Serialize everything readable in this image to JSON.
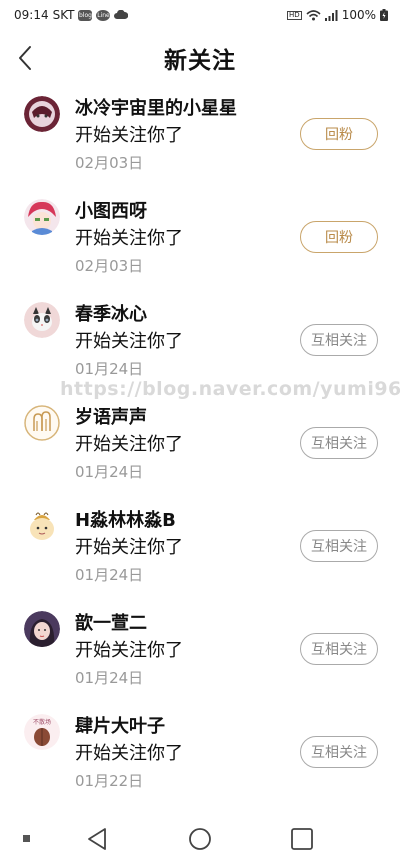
{
  "status_bar": {
    "time": "09:14",
    "carrier": "SKT",
    "app_badges": [
      "blog",
      "Line"
    ],
    "hd_label": "HD",
    "battery": "100%"
  },
  "header": {
    "title": "新关注"
  },
  "items": [
    {
      "name": "冰冷宇宙里的小星星",
      "message": "开始关注你了",
      "date": "02月03日",
      "button": "回粉",
      "button_style": "follow-back"
    },
    {
      "name": "小图西呀",
      "message": "开始关注你了",
      "date": "02月03日",
      "button": "回粉",
      "button_style": "follow-back"
    },
    {
      "name": "春季冰心",
      "message": "开始关注你了",
      "date": "01月24日",
      "button": "互相关注",
      "button_style": "mutual"
    },
    {
      "name": "岁语声声",
      "message": "开始关注你了",
      "date": "01月24日",
      "button": "互相关注",
      "button_style": "mutual"
    },
    {
      "name": "H淼林林淼B",
      "message": "开始关注你了",
      "date": "01月24日",
      "button": "互相关注",
      "button_style": "mutual"
    },
    {
      "name": "歆一萱二",
      "message": "开始关注你了",
      "date": "01月24日",
      "button": "互相关注",
      "button_style": "mutual"
    },
    {
      "name": "肆片大叶子",
      "message": "开始关注你了",
      "date": "01月22日",
      "button": "互相关注",
      "button_style": "mutual"
    }
  ],
  "avatar_caption": "不散场",
  "watermark": "https://blog.naver.com/yumi96",
  "colors": {
    "follow_back": "#b98b4a",
    "mutual": "#888888",
    "date": "#999999"
  }
}
